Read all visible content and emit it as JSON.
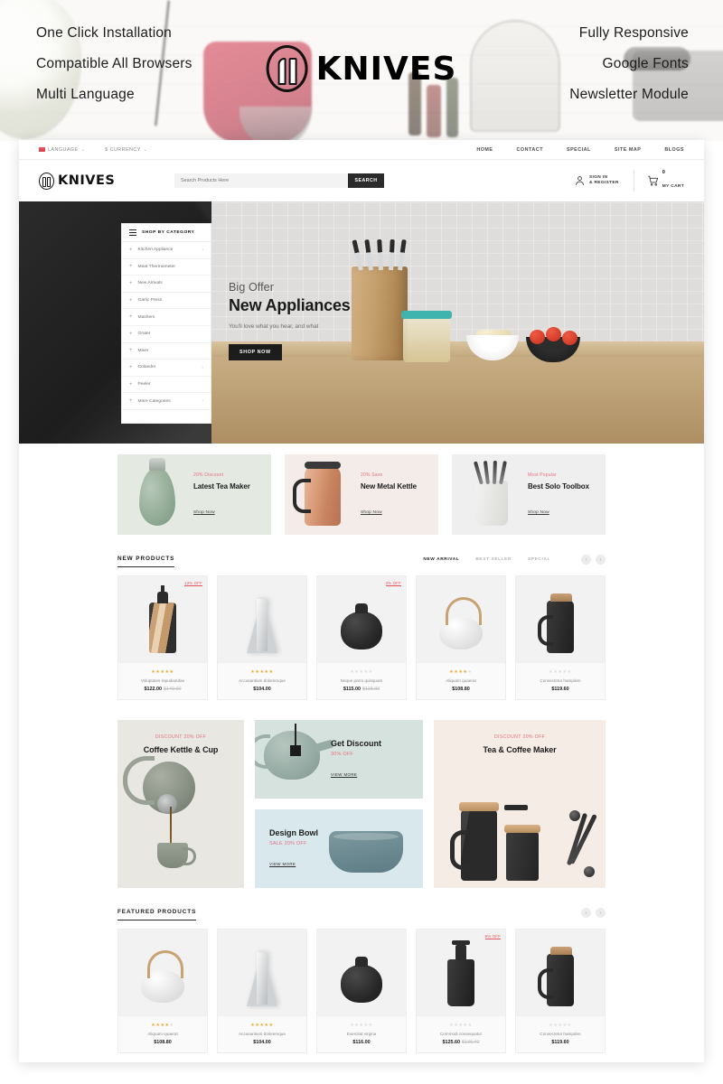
{
  "promo": {
    "left_features": [
      "One Click Installation",
      "Compatible All Browsers",
      "Multi Language"
    ],
    "right_features": [
      "Fully Responsive",
      "Google Fonts",
      "Newsletter Module"
    ],
    "brand": "KNIVES"
  },
  "topbar": {
    "language": "LANGUAGE",
    "currency": "$ CURRENCY",
    "caret": "⌄",
    "nav": [
      "HOME",
      "CONTACT",
      "SPECIAL",
      "SITE MAP",
      "BLOGS"
    ]
  },
  "header": {
    "brand": "KNIVES",
    "search_placeholder": "Search Products Here",
    "search_value": "",
    "search_button": "SEARCH",
    "account_line1": "SIGN IN",
    "account_line2": "& REGISTER",
    "cart_count": "0",
    "cart_label": "MY CART"
  },
  "category_panel": {
    "heading": "SHOP BY CATEGORY",
    "items": [
      {
        "label": "Kitchen Appliance",
        "has_children": true
      },
      {
        "label": "Meat Thermometer",
        "has_children": false
      },
      {
        "label": "New Arrivals",
        "has_children": false
      },
      {
        "label": "Garlic Press",
        "has_children": false
      },
      {
        "label": "Mashers",
        "has_children": false
      },
      {
        "label": "Grater",
        "has_children": false
      },
      {
        "label": "Mixer",
        "has_children": false
      },
      {
        "label": "Colander",
        "has_children": true
      },
      {
        "label": "Peeler",
        "has_children": false
      },
      {
        "label": "More Categories",
        "has_children": true
      }
    ],
    "plus": "+",
    "arrow": "›"
  },
  "hero": {
    "subtitle": "Big Offer",
    "title": "New Appliances",
    "description": "You'll love what you hear, and what",
    "button": "SHOP NOW"
  },
  "promo_cards": [
    {
      "kicker": "20% Discount",
      "title": "Latest Tea Maker",
      "link": "Shop Now",
      "bg": "#e4eae2"
    },
    {
      "kicker": "20% Save",
      "title": "New Metal Kettle",
      "link": "Shop Now",
      "bg": "#f3ece8"
    },
    {
      "kicker": "Most Popular",
      "title": "Best Solo Toolbox",
      "link": "Shop Now",
      "bg": "#efefef"
    }
  ],
  "new_products": {
    "title": "NEW PRODUCTS",
    "tabs": [
      {
        "label": "NEW ARRIVAL",
        "active": true
      },
      {
        "label": "BEST SELLER",
        "active": false
      },
      {
        "label": "SPECIAL",
        "active": false
      }
    ],
    "prev": "‹",
    "next": "›",
    "items": [
      {
        "name": "Voluptates repudiandae",
        "price": "$122.00",
        "old_price": "$140.00",
        "badge": "13% OFF",
        "rating": 5
      },
      {
        "name": "Accusantium doloremque",
        "price": "$104.00",
        "old_price": "",
        "badge": "",
        "rating": 5
      },
      {
        "name": "Neque porro quisquam",
        "price": "$115.00",
        "old_price": "$118.00",
        "badge": "3% OFF",
        "rating": 0
      },
      {
        "name": "Aliquam quaerat",
        "price": "$108.80",
        "old_price": "",
        "badge": "",
        "rating": 4
      },
      {
        "name": "Consectetur hampden",
        "price": "$119.60",
        "old_price": "",
        "badge": "",
        "rating": 0
      }
    ]
  },
  "mid_banners": {
    "left": {
      "kicker": "DISCOUNT 20% OFF",
      "title": "Coffee Kettle & Cup"
    },
    "center_top": {
      "title": "Get Discount",
      "sub": "30% OFF",
      "link": "VIEW MORE"
    },
    "center_bottom": {
      "title": "Design Bowl",
      "sub": "SALE 20% OFF",
      "link": "VIEW MORE"
    },
    "right": {
      "kicker": "DISCOUNT 20% OFF",
      "title": "Tea & Coffee Maker"
    }
  },
  "featured_products": {
    "title": "FEATURED PRODUCTS",
    "prev": "‹",
    "next": "›",
    "items": [
      {
        "name": "Aliquam quaerat",
        "price": "$108.80",
        "old_price": "",
        "badge": "",
        "rating": 4
      },
      {
        "name": "Accusantium doloremque",
        "price": "$104.00",
        "old_price": "",
        "badge": "",
        "rating": 5
      },
      {
        "name": "Exercitat virgina",
        "price": "$116.00",
        "old_price": "",
        "badge": "",
        "rating": 0
      },
      {
        "name": "Commodi consequatur",
        "price": "$125.60",
        "old_price": "$136.40",
        "badge": "8% OFF",
        "rating": 0
      },
      {
        "name": "Consectetur hampden",
        "price": "$119.60",
        "old_price": "",
        "badge": "",
        "rating": 0
      }
    ]
  },
  "colors": {
    "accent_pink": "#e4717f",
    "accent_red": "#e8505b",
    "dark": "#1b1b1b",
    "star_gold": "#f0a62c"
  }
}
